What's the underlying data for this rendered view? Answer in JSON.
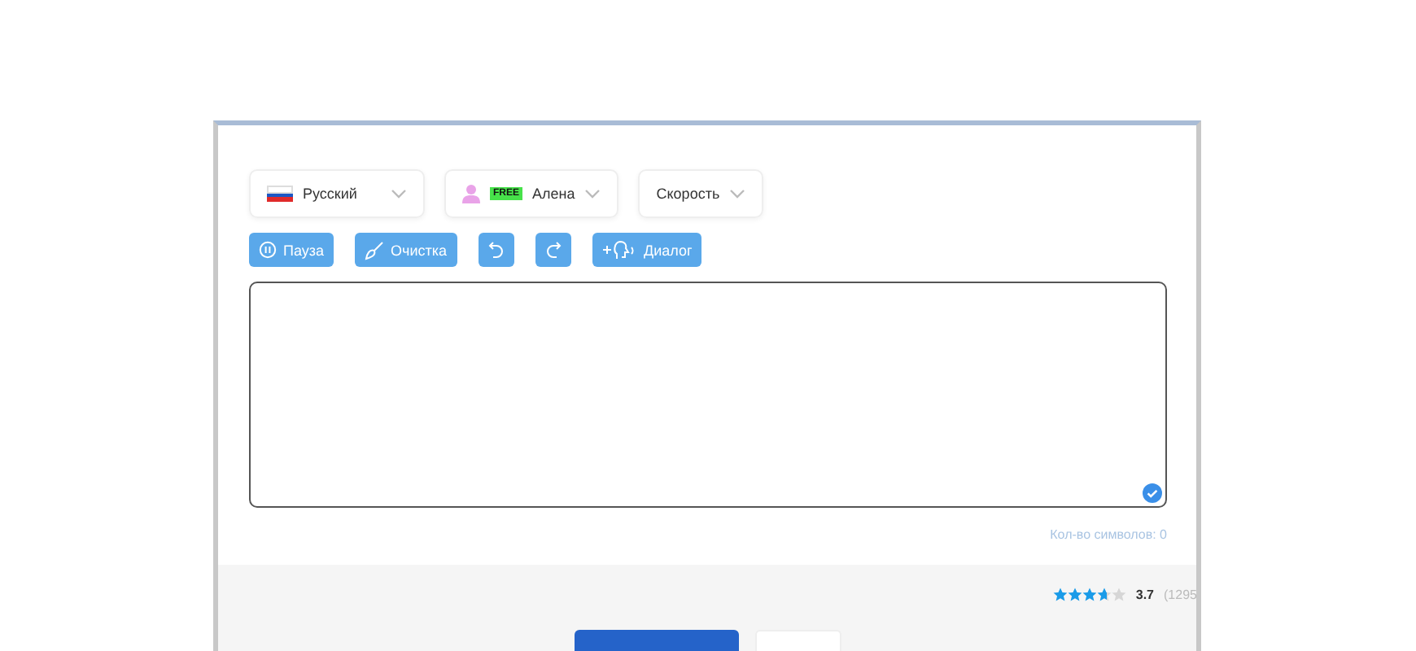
{
  "selects": [
    {
      "kind": "language",
      "label": "Русский"
    },
    {
      "kind": "voice",
      "badge": "FREE",
      "label": "Алена"
    },
    {
      "kind": "plain",
      "label": "Скорость"
    }
  ],
  "toolbar": [
    {
      "kind": "pause",
      "label": "Пауза"
    },
    {
      "kind": "clear",
      "label": "Очистка"
    },
    {
      "kind": "undo"
    },
    {
      "kind": "redo"
    },
    {
      "kind": "dialog",
      "label": "Диалог"
    }
  ],
  "editor": {
    "checked": true
  },
  "char_count": "Кол-во символов: 0",
  "rating": {
    "stars": 3.7,
    "value": "3.7",
    "count": "(1295"
  }
}
